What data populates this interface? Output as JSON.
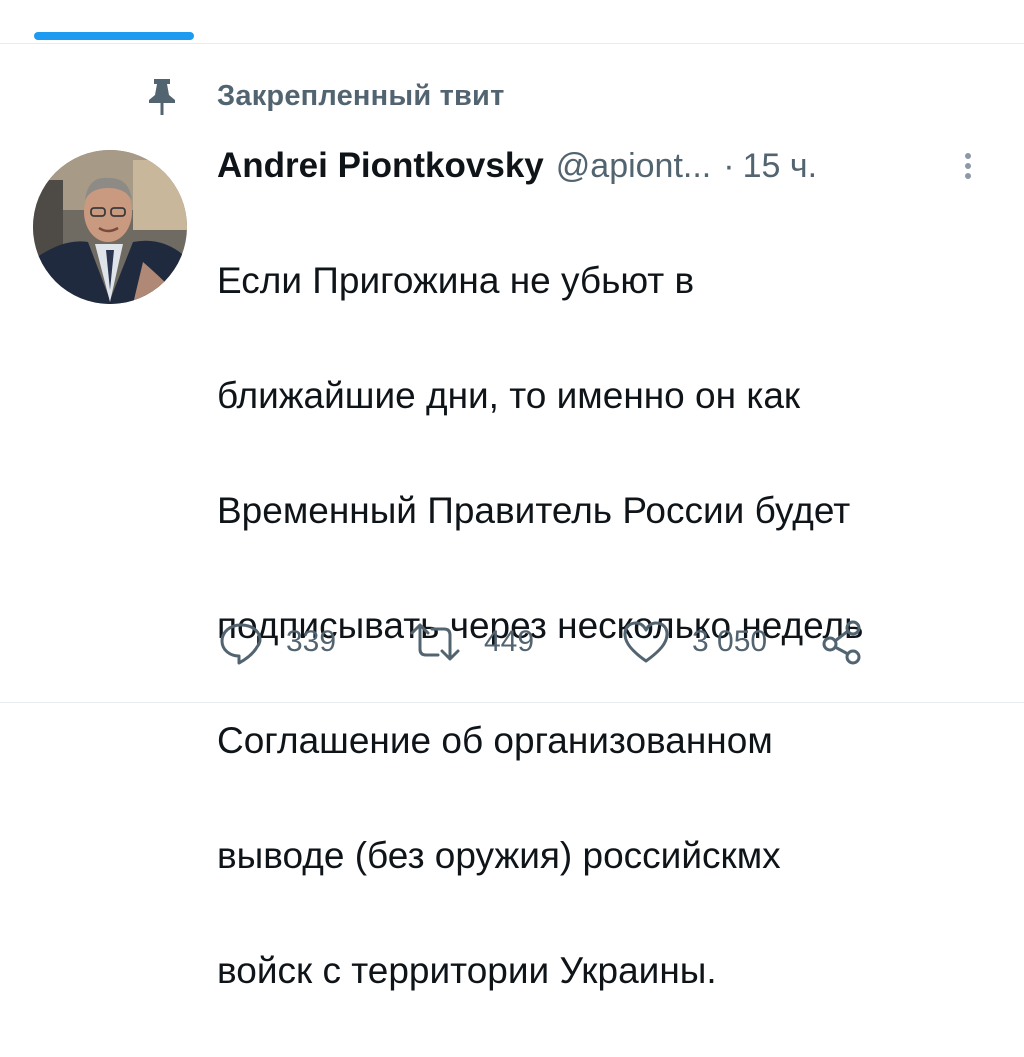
{
  "pinned": {
    "label": "Закрепленный твит",
    "icon": "pin-icon"
  },
  "tweet": {
    "author": {
      "name": "Andrei Piontkovsky",
      "handle": "@apiont...",
      "avatar": "avatar"
    },
    "separator": "·",
    "timestamp": "15 ч.",
    "text_lines": [
      "Если Пригожина не убьют в",
      "ближайшие дни, то именно он как",
      "Временный Правитель России будет",
      "подписывать через несколько недель",
      "Соглашение об организованном",
      "выводе (без оружия) российскмх",
      "войск с территории Украины."
    ],
    "actions": {
      "replies": {
        "icon": "reply-icon",
        "count": "339"
      },
      "retweets": {
        "icon": "retweet-icon",
        "count": "449"
      },
      "likes": {
        "icon": "heart-icon",
        "count": "3 050"
      },
      "share": {
        "icon": "share-icon"
      }
    }
  },
  "colors": {
    "accent": "#1d9bf0",
    "secondary_text": "#536471",
    "primary_text": "#0f1419"
  }
}
